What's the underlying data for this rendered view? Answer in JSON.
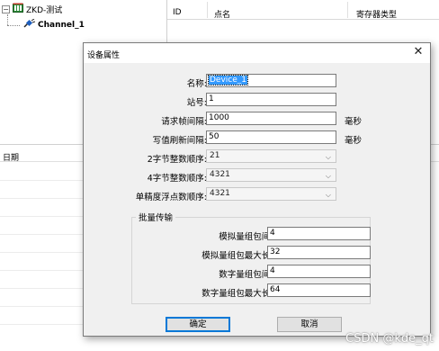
{
  "tree": {
    "root_label": "ZKD-测试",
    "channel_label": "Channel_1"
  },
  "grid": {
    "columns": [
      "ID",
      "点名",
      "寄存器类型"
    ]
  },
  "log": {
    "date_header": "日期"
  },
  "dialog": {
    "title": "设备属性",
    "close_glyph": "✕",
    "name_label": "名称:",
    "name_value": "Device_1",
    "station_label": "站号:",
    "station_value": "1",
    "request_interval_label": "请求帧间隔:",
    "request_interval_value": "1000",
    "request_interval_unit": "毫秒",
    "write_refresh_label": "写值刷新间隔:",
    "write_refresh_value": "50",
    "write_refresh_unit": "毫秒",
    "byte2_order_label": "2字节整数顺序:",
    "byte2_order_value": "21",
    "byte4_order_label": "4字节整数顺序:",
    "byte4_order_value": "4321",
    "float_order_label": "单精度浮点数顺序:",
    "float_order_value": "4321",
    "batch_group_label": "批量传输",
    "analog_interval_label": "模拟量组包间隔:",
    "analog_interval_value": "4",
    "analog_maxlen_label": "模拟量组包最大长度:",
    "analog_maxlen_value": "32",
    "digital_interval_label": "数字量组包间隔:",
    "digital_interval_value": "4",
    "digital_maxlen_label": "数字量组包最大长度:",
    "digital_maxlen_value": "64",
    "ok_label": "确定",
    "cancel_label": "取消"
  },
  "watermark": "CSDN @kde_qt",
  "colors": {
    "selection": "#3399ff",
    "default_button_border": "#0078d7",
    "dialog_bg": "#f0f0f0"
  },
  "icons": {
    "root": "database-icon",
    "channel": "channel-plug-icon",
    "expander": "tree-collapse-icon"
  }
}
